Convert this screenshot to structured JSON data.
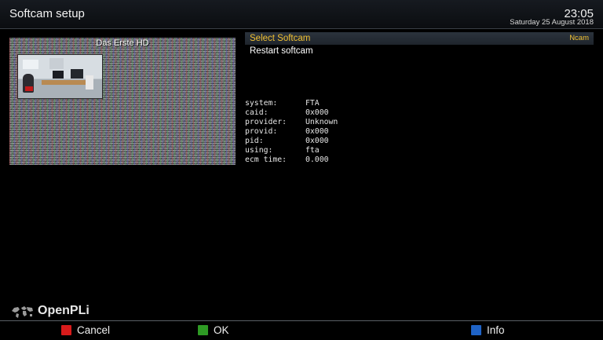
{
  "header": {
    "title": "Softcam setup",
    "time": "23:05",
    "date": "Saturday 25 August 2018"
  },
  "pip": {
    "channel": "Das Erste HD"
  },
  "menu": {
    "items": [
      {
        "label": "Select Softcam",
        "value": "Ncam",
        "selected": true
      },
      {
        "label": "Restart softcam",
        "value": "",
        "selected": false
      }
    ]
  },
  "info": {
    "rows": [
      {
        "key": "system:",
        "value": "FTA"
      },
      {
        "key": "caid:",
        "value": "0x000"
      },
      {
        "key": "provider:",
        "value": "Unknown"
      },
      {
        "key": "provid:",
        "value": "0x000"
      },
      {
        "key": "pid:",
        "value": "0x000"
      },
      {
        "key": "using:",
        "value": "fta"
      },
      {
        "key": "ecm time:",
        "value": "0.000"
      }
    ]
  },
  "brand": {
    "name": "OpenPLi",
    "icon": "globe-map-icon"
  },
  "footer": {
    "buttons": [
      {
        "label": "Cancel",
        "color": "#d81b1b",
        "icon": "red-key-icon"
      },
      {
        "label": "OK",
        "color": "#2e9a24",
        "icon": "green-key-icon"
      },
      {
        "label": "Info",
        "color": "#1f63c6",
        "icon": "blue-key-icon"
      }
    ]
  },
  "colors": {
    "accent": "#f2c233",
    "selection_bg": "#2b333d"
  }
}
